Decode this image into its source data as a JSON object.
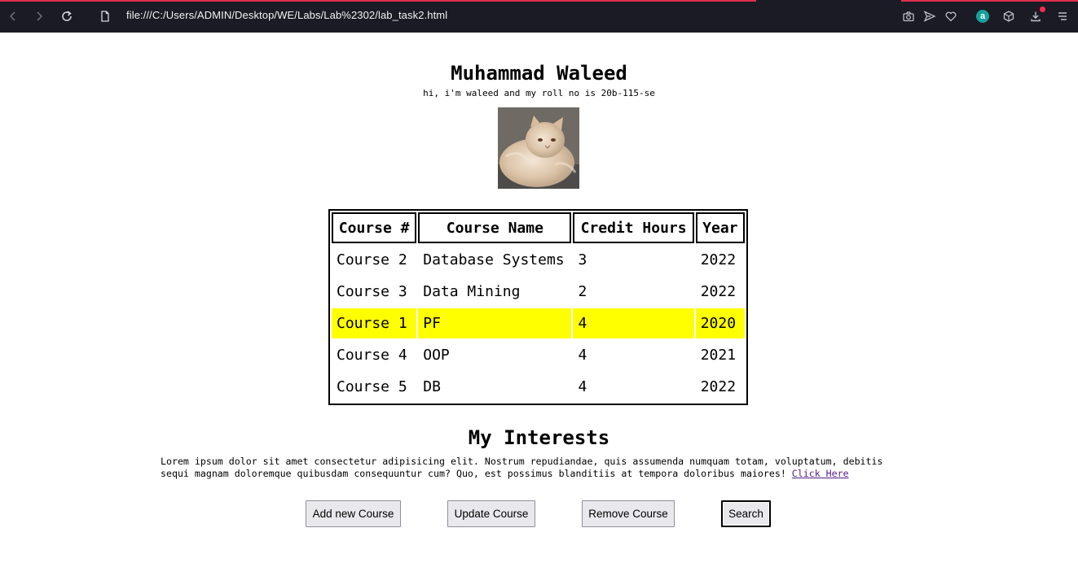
{
  "browser": {
    "url": "file:///C:/Users/ADMIN/Desktop/WE/Labs/Lab%2302/lab_task2.html"
  },
  "profile": {
    "name": "Muhammad Waleed",
    "tagline": "hi, i'm waleed and my roll no is 20b-115-se"
  },
  "courses": {
    "headers": [
      "Course #",
      "Course Name",
      "Credit Hours",
      "Year"
    ],
    "rows": [
      [
        "Course 2",
        "Database Systems",
        "3",
        "2022"
      ],
      [
        "Course 3",
        "Data Mining",
        "2",
        "2022"
      ],
      [
        "Course 1",
        "PF",
        "4",
        "2020"
      ],
      [
        "Course 4",
        "OOP",
        "4",
        "2021"
      ],
      [
        "Course 5",
        "DB",
        "4",
        "2022"
      ]
    ],
    "highlight_color": "#ffff00"
  },
  "interests": {
    "title": "My Interests",
    "line1": "Lorem ipsum dolor sit amet consectetur adipisicing elit. Nostrum repudiandae, quis assumenda numquam totam, voluptatum, debitis",
    "line2": "sequi magnam doloremque quibusdam consequuntur cum? Quo, est possimus blanditiis at tempora doloribus maiores! ",
    "link": "Click Here"
  },
  "buttons": {
    "add": "Add new Course",
    "update": "Update Course",
    "remove": "Remove Course",
    "search": "Search"
  }
}
